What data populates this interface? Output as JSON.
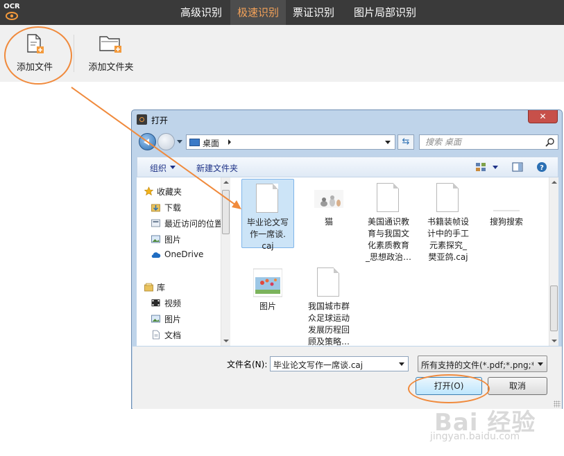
{
  "app": {
    "logo_text": "OCR",
    "tabs": [
      {
        "label": "高级识别",
        "active": false
      },
      {
        "label": "极速识别",
        "active": true
      },
      {
        "label": "票证识别",
        "active": false
      },
      {
        "label": "图片局部识别",
        "active": false
      }
    ],
    "toolbar": {
      "add_file_label": "添加文件",
      "add_folder_label": "添加文件夹"
    }
  },
  "dialog": {
    "title": "打开",
    "close_label": "✕",
    "address": "桌面",
    "search_placeholder": "搜索 桌面",
    "commands": {
      "organize": "组织",
      "new_folder": "新建文件夹"
    },
    "nav_tree": [
      {
        "label": "收藏夹",
        "icon": "star-icon"
      },
      {
        "label": "下载",
        "icon": "download-folder-icon"
      },
      {
        "label": "最近访问的位置",
        "icon": "recent-places-icon"
      },
      {
        "label": "图片",
        "icon": "pictures-icon"
      },
      {
        "label": "OneDrive",
        "icon": "cloud-icon"
      },
      {
        "label": "库",
        "icon": "library-icon"
      },
      {
        "label": "视频",
        "icon": "video-icon"
      },
      {
        "label": "图片",
        "icon": "pictures-icon"
      },
      {
        "label": "文档",
        "icon": "documents-icon"
      }
    ],
    "files": [
      {
        "name": "毕业论文写作一席谈.caj",
        "display": "毕业论文写\n作一席谈.\ncaj",
        "kind": "document",
        "selected": true
      },
      {
        "name": "猫",
        "display": "猫",
        "kind": "image-cat",
        "selected": false
      },
      {
        "name": "美国通识教育与我国文化素质教育_思想政治…",
        "display": "美国通识教\n育与我国文\n化素质教育\n_思想政治…",
        "kind": "document",
        "selected": false
      },
      {
        "name": "书籍装帧设计中的手工元素探究_樊亚鸽.caj",
        "display": "书籍装帧设\n计中的手工\n元素探究_\n樊亚鸽.caj",
        "kind": "document",
        "selected": false
      },
      {
        "name": "搜狗搜索",
        "display": "搜狗搜索",
        "kind": "shortcut",
        "selected": false
      },
      {
        "name": "图片",
        "display": "图片",
        "kind": "image-photo",
        "selected": false
      },
      {
        "name": "我国城市群众足球运动发展历程回顾及策略…",
        "display": "我国城市群\n众足球运动\n发展历程回\n顾及策略…",
        "kind": "document",
        "selected": false
      }
    ],
    "filename_label": "文件名(N):",
    "filename_value": "毕业论文写作一席谈.caj",
    "filetype_value": "所有支持的文件(*.pdf;*.png;*.j",
    "open_button": "打开(O)",
    "cancel_button": "取消"
  },
  "watermark": {
    "brand": "Bai 经验",
    "url": "jingyan.baidu.com"
  },
  "colors": {
    "annotation": "#f08a3c",
    "active_tab_text": "#f4a259",
    "topbar_bg": "#3a3a3a"
  }
}
